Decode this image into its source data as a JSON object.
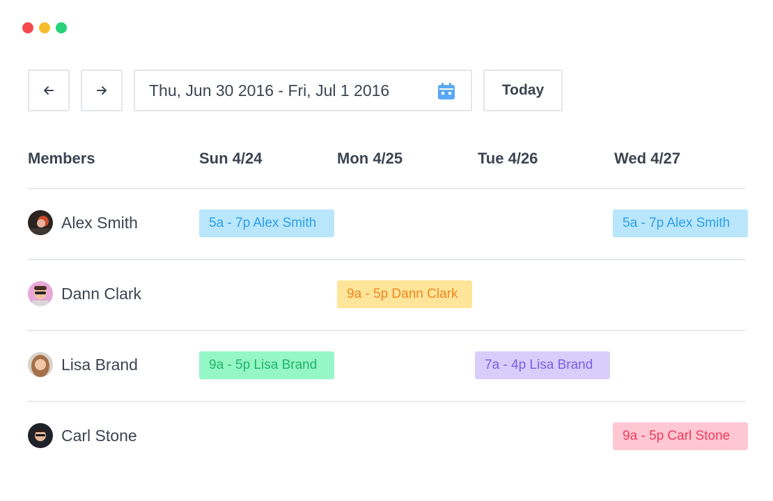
{
  "window_controls": [
    "close",
    "minimize",
    "maximize"
  ],
  "toolbar": {
    "prev_icon": "arrow-left-icon",
    "next_icon": "arrow-right-icon",
    "date_range": "Thu, Jun 30 2016 - Fri, Jul 1 2016",
    "calendar_icon": "calendar-icon",
    "calendar_color": "#5aa8f5",
    "today_label": "Today"
  },
  "header": {
    "members_label": "Members",
    "days": [
      "Sun 4/24",
      "Mon 4/25",
      "Tue 4/26",
      "Wed 4/27"
    ]
  },
  "rows": [
    {
      "name": "Alex Smith",
      "shifts": [
        {
          "day": 0,
          "label": "5a - 7p Alex Smith",
          "color": "#b9e6fb"
        },
        {
          "day": 3,
          "label": "5a - 7p Alex Smith",
          "color": "#b9e6fb"
        }
      ]
    },
    {
      "name": "Dann Clark",
      "shifts": [
        {
          "day": 1,
          "label": "9a - 5p Dann Clark",
          "color": "#ffe59a"
        }
      ]
    },
    {
      "name": "Lisa Brand",
      "shifts": [
        {
          "day": 0,
          "label": "9a - 5p Lisa Brand",
          "color": "#96f7c6"
        },
        {
          "day": 2,
          "label": "7a - 4p Lisa Brand",
          "color": "#d9cdfb"
        }
      ]
    },
    {
      "name": "Carl Stone",
      "shifts": [
        {
          "day": 3,
          "label": "9a - 5p Carl Stone",
          "color": "#ffc7d1"
        }
      ]
    }
  ]
}
